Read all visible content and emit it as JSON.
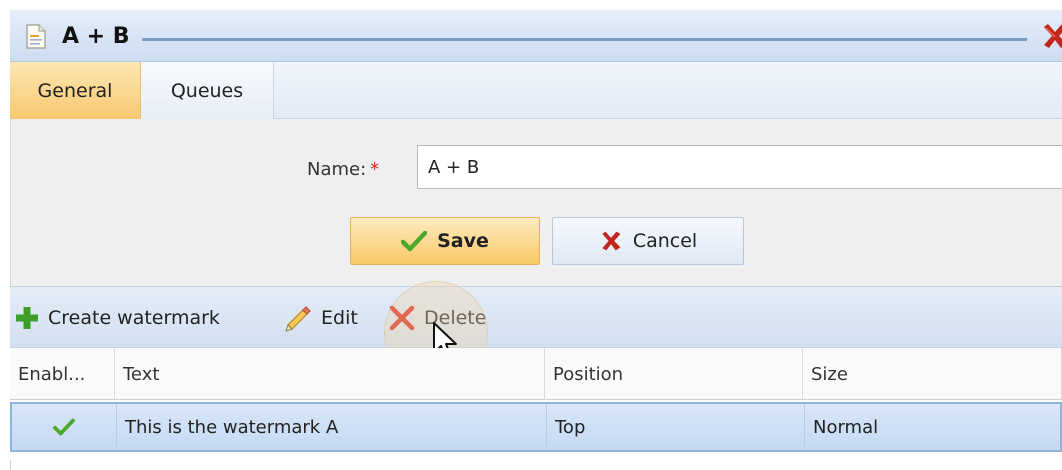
{
  "window": {
    "title": "A + B",
    "icon": "document-icon",
    "close_icon": "close-icon"
  },
  "tabs": [
    {
      "label": "General",
      "active": true
    },
    {
      "label": "Queues",
      "active": false
    }
  ],
  "form": {
    "name_label": "Name:",
    "required_marker": "*",
    "name_value": "A + B",
    "save_label": "Save",
    "cancel_label": "Cancel"
  },
  "toolbar": {
    "create_label": "Create watermark",
    "edit_label": "Edit",
    "delete_label": "Delete",
    "icons": [
      "plus-icon",
      "pencil-icon",
      "delete-x-icon"
    ]
  },
  "table": {
    "columns": [
      "Enabl...",
      "Text",
      "Position",
      "Size"
    ],
    "rows": [
      {
        "enabled": true,
        "text": "This is the watermark A",
        "position": "Top",
        "size": "Normal"
      }
    ]
  },
  "colors": {
    "accent_orange": "#f8c866",
    "header_blue": "#cddcf1",
    "selection_blue": "#c4d9f3",
    "check_green": "#4aa82b",
    "delete_red": "#d9261c"
  }
}
